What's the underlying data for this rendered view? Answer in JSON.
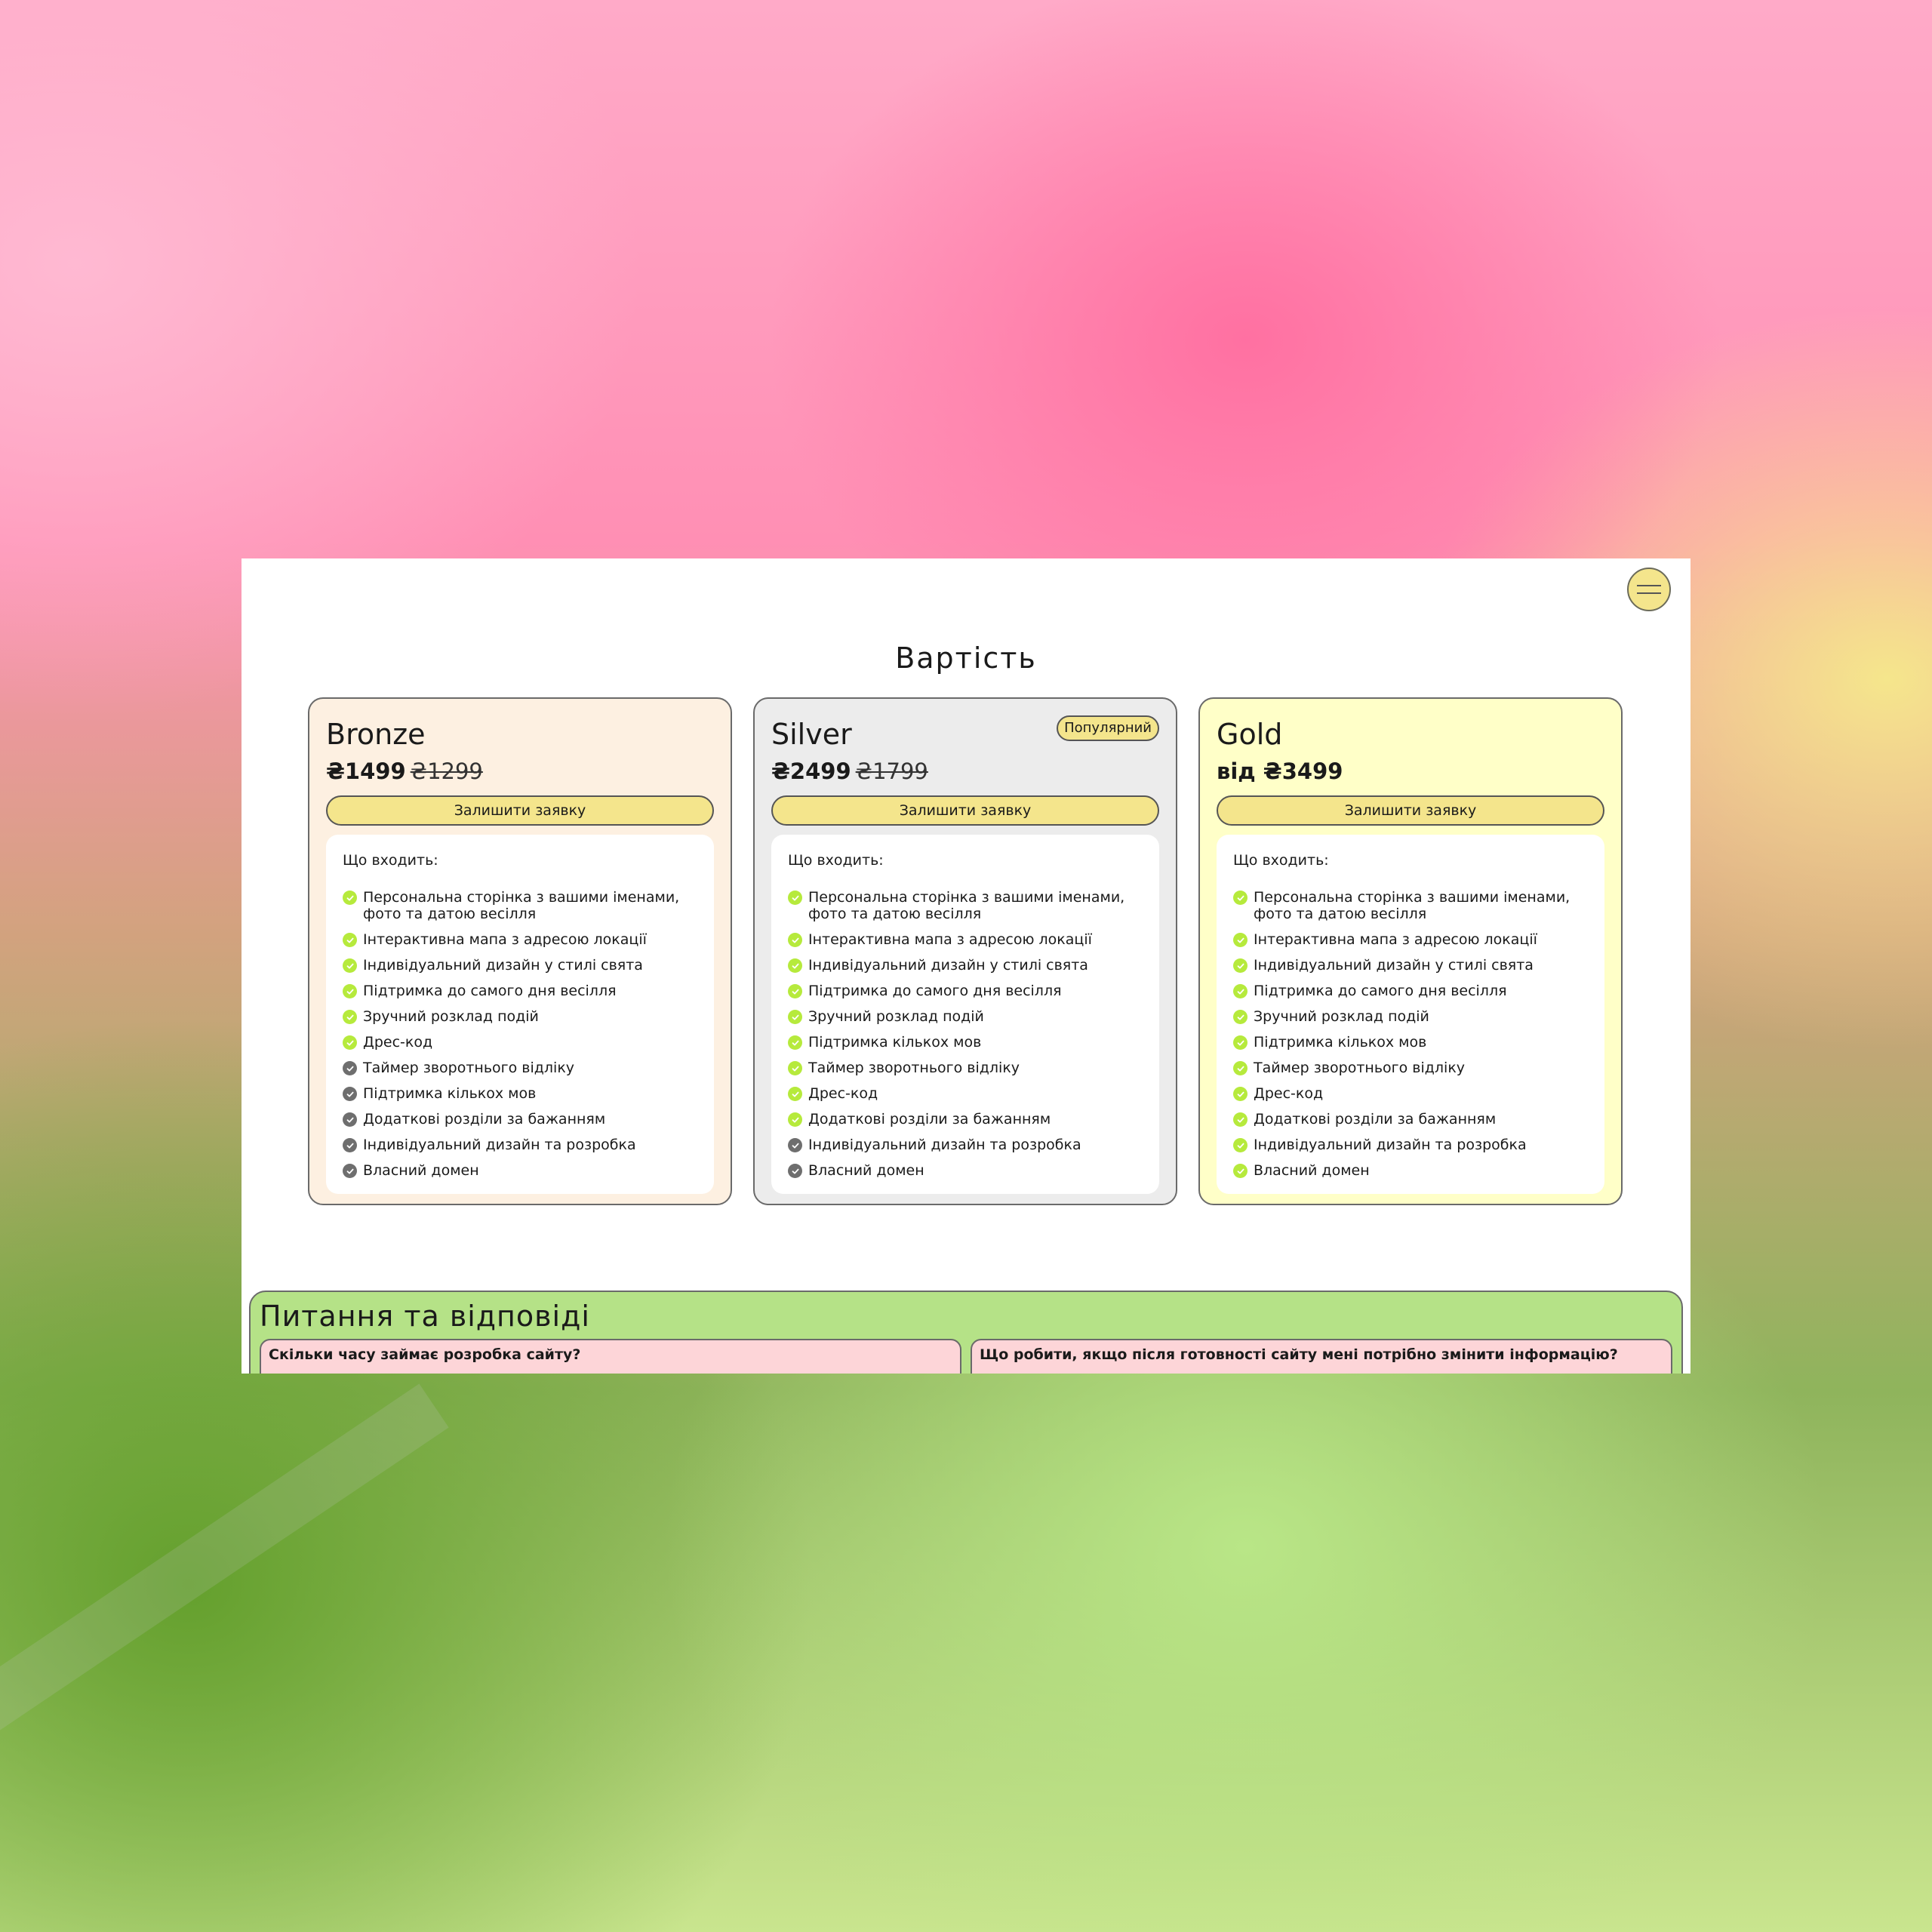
{
  "header": {
    "menu_icon": "hamburger-icon"
  },
  "pricing": {
    "title": "Вартість",
    "features_title": "Що входить:",
    "plans": [
      {
        "name": "Bronze",
        "price": "₴1499",
        "old_price": "₴1299",
        "cta": "Залишити заявку",
        "features": [
          {
            "text": "Персональна сторінка з вашими іменами, фото та датою весілля",
            "included": true
          },
          {
            "text": "Інтерактивна мапа з адресою локації",
            "included": true
          },
          {
            "text": "Індивідуальний дизайн у стилі свята",
            "included": true
          },
          {
            "text": "Підтримка до самого дня весілля",
            "included": true
          },
          {
            "text": "Зручний розклад подій",
            "included": true
          },
          {
            "text": "Дрес-код",
            "included": true
          },
          {
            "text": "Таймер зворотнього відліку",
            "included": false
          },
          {
            "text": "Підтримка кількох мов",
            "included": false
          },
          {
            "text": "Додаткові розділи за бажанням",
            "included": false
          },
          {
            "text": "Індивідуальний дизайн та розробка",
            "included": false
          },
          {
            "text": "Власний домен",
            "included": false
          }
        ]
      },
      {
        "name": "Silver",
        "badge": "Популярний",
        "price": "₴2499",
        "old_price": "₴1799",
        "cta": "Залишити заявку",
        "features": [
          {
            "text": "Персональна сторінка з вашими іменами, фото та датою весілля",
            "included": true
          },
          {
            "text": "Інтерактивна мапа з адресою локації",
            "included": true
          },
          {
            "text": "Індивідуальний дизайн у стилі свята",
            "included": true
          },
          {
            "text": "Підтримка до самого дня весілля",
            "included": true
          },
          {
            "text": "Зручний розклад подій",
            "included": true
          },
          {
            "text": "Підтримка кількох мов",
            "included": true
          },
          {
            "text": "Таймер зворотнього відліку",
            "included": true
          },
          {
            "text": "Дрес-код",
            "included": true
          },
          {
            "text": "Додаткові розділи за бажанням",
            "included": true
          },
          {
            "text": "Індивідуальний дизайн та розробка",
            "included": false
          },
          {
            "text": "Власний домен",
            "included": false
          }
        ]
      },
      {
        "name": "Gold",
        "price": "від ₴3499",
        "old_price": "",
        "cta": "Залишити заявку",
        "features": [
          {
            "text": "Персональна сторінка з вашими іменами, фото та датою весілля",
            "included": true
          },
          {
            "text": "Інтерактивна мапа з адресою локації",
            "included": true
          },
          {
            "text": "Індивідуальний дизайн у стилі свята",
            "included": true
          },
          {
            "text": "Підтримка до самого дня весілля",
            "included": true
          },
          {
            "text": "Зручний розклад подій",
            "included": true
          },
          {
            "text": "Підтримка кількох мов",
            "included": true
          },
          {
            "text": "Таймер зворотнього відліку",
            "included": true
          },
          {
            "text": "Дрес-код",
            "included": true
          },
          {
            "text": "Додаткові розділи за бажанням",
            "included": true
          },
          {
            "text": "Індивідуальний дизайн та розробка",
            "included": true
          },
          {
            "text": "Власний домен",
            "included": true
          }
        ]
      }
    ]
  },
  "faq": {
    "title": "Питання та відповіді",
    "items": [
      {
        "question": "Скільки часу займає розробка сайту?"
      },
      {
        "question": "Що робити, якщо після готовності сайту мені потрібно змінити інформацію?"
      }
    ]
  },
  "colors": {
    "accent_yellow": "#f4e58c",
    "check_included": "#b6ea3c",
    "check_excluded": "#6e6e6e",
    "bronze_bg": "#fdf0e1",
    "silver_bg": "#ececec",
    "gold_bg": "#ffffc8",
    "faq_bg": "#b5e287",
    "faq_item_bg": "#fdd5d8"
  }
}
